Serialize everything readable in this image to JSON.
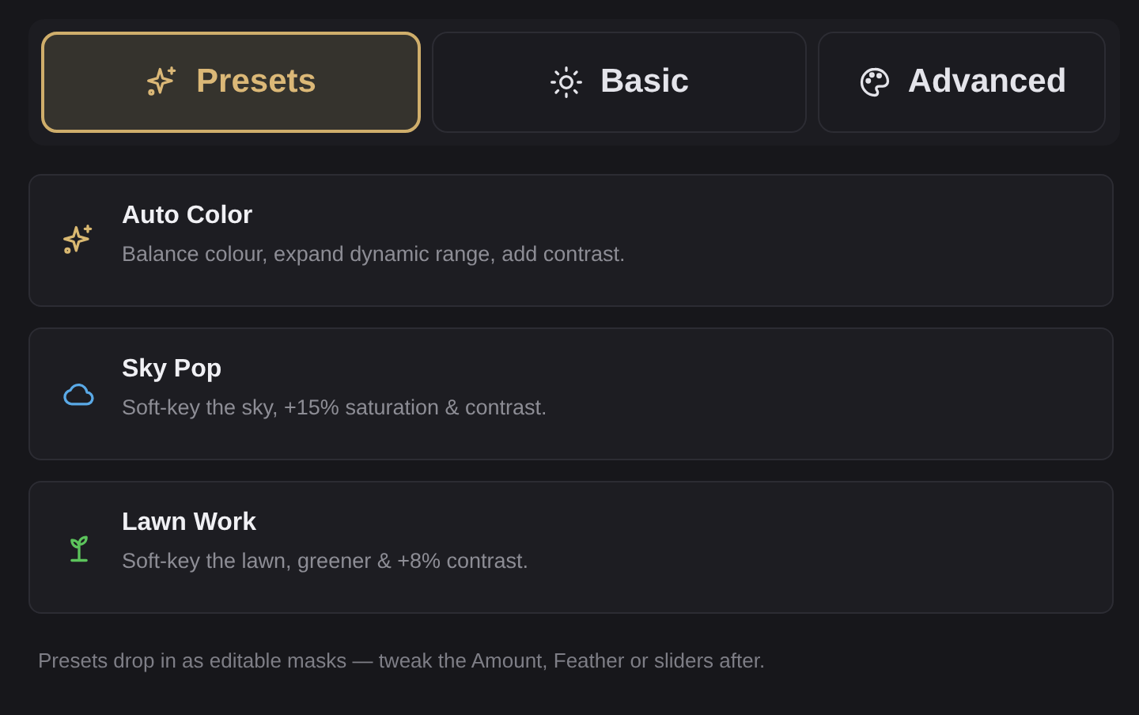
{
  "tabs": [
    {
      "label": "Presets",
      "selected": true
    },
    {
      "label": "Basic",
      "selected": false
    },
    {
      "label": "Advanced",
      "selected": false
    }
  ],
  "presets": [
    {
      "title": "Auto Color",
      "description": "Balance colour, expand dynamic range, add contrast.",
      "color": "#d9b871"
    },
    {
      "title": "Sky Pop",
      "description": "Soft-key the sky, +15% saturation & contrast.",
      "color": "#5aa9e6"
    },
    {
      "title": "Lawn Work",
      "description": "Soft-key the lawn, greener & +8% contrast.",
      "color": "#5cc45c"
    }
  ],
  "footer_note": "Presets drop in as editable masks — tweak the Amount, Feather or sliders after."
}
